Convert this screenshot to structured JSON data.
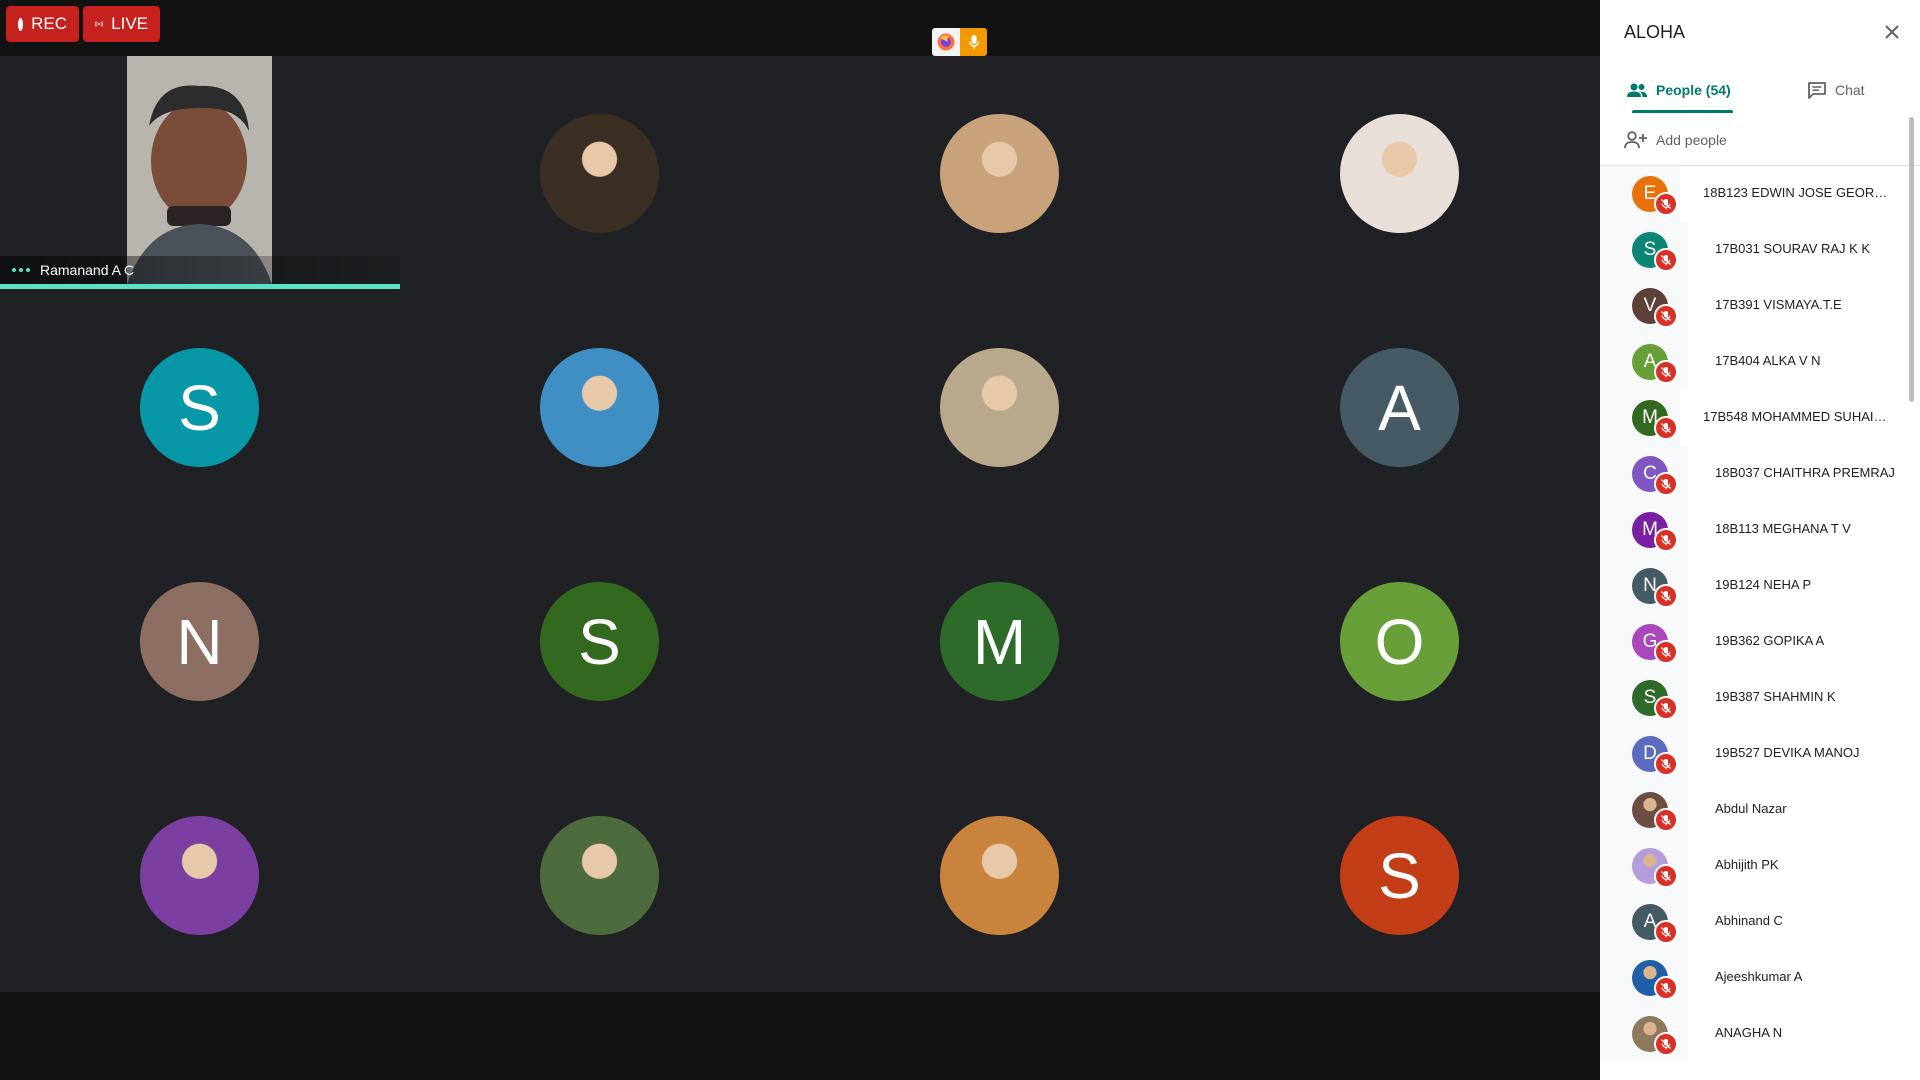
{
  "top_bar": {
    "rec_label": "REC",
    "live_label": "LIVE"
  },
  "speaker_tile": {
    "name": "Ramanand A C"
  },
  "grid_tiles": [
    {
      "type": "photo",
      "color": "#3b2e22"
    },
    {
      "type": "photo",
      "color": "#c7a27a"
    },
    {
      "type": "photo",
      "color": "#e8e0d8"
    },
    {
      "type": "letter",
      "letter": "S",
      "color": "#0897a6"
    },
    {
      "type": "photo",
      "color": "#3f8fc4"
    },
    {
      "type": "photo",
      "color": "#b9a98c"
    },
    {
      "type": "letter",
      "letter": "A",
      "color": "#455a64"
    },
    {
      "type": "letter",
      "letter": "N",
      "color": "#8d6e63"
    },
    {
      "type": "letter",
      "letter": "S",
      "color": "#33691e"
    },
    {
      "type": "letter",
      "letter": "M",
      "color": "#2e6b2a"
    },
    {
      "type": "letter",
      "letter": "O",
      "color": "#689f38"
    },
    {
      "type": "photo",
      "color": "#7a3fa0"
    },
    {
      "type": "photo",
      "color": "#4d6b3c"
    },
    {
      "type": "photo",
      "color": "#c9833c"
    },
    {
      "type": "letter",
      "letter": "S",
      "color": "#c33d17"
    }
  ],
  "panel": {
    "title": "ALOHA",
    "tab_people": "People (54)",
    "tab_chat": "Chat",
    "add_people": "Add people"
  },
  "participants": [
    {
      "name": "18B123 EDWIN JOSE GEORGE ...",
      "initial": "E",
      "color": "#e8710a",
      "wide": true
    },
    {
      "name": "17B031 SOURAV RAJ K K",
      "initial": "S",
      "color": "#0b8574",
      "wide": false
    },
    {
      "name": "17B391 VISMAYA.T.E",
      "initial": "V",
      "color": "#5d4037",
      "wide": false
    },
    {
      "name": "17B404 ALKA V N",
      "initial": "A",
      "color": "#689f38",
      "wide": false
    },
    {
      "name": "17B548 MOHAMMED SUHAIL ...",
      "initial": "M",
      "color": "#33691e",
      "wide": true
    },
    {
      "name": "18B037 CHAITHRA PREMRAJ",
      "initial": "C",
      "color": "#7e57c2",
      "wide": false
    },
    {
      "name": "18B113 MEGHANA T V",
      "initial": "M",
      "color": "#7b1fa2",
      "wide": false
    },
    {
      "name": "19B124 NEHA P",
      "initial": "N",
      "color": "#455a64",
      "wide": false
    },
    {
      "name": "19B362 GOPIKA A",
      "initial": "G",
      "color": "#ab47bc",
      "wide": false
    },
    {
      "name": "19B387 SHAHMIN K",
      "initial": "S",
      "color": "#2e6b2a",
      "wide": false
    },
    {
      "name": "19B527 DEVIKA MANOJ",
      "initial": "D",
      "color": "#5c6bc0",
      "wide": false
    },
    {
      "name": "Abdul Nazar",
      "initial": "",
      "color": "#6d4c41",
      "wide": false
    },
    {
      "name": "Abhijith PK",
      "initial": "",
      "color": "#b39ddb",
      "wide": false
    },
    {
      "name": "Abhinand C",
      "initial": "A",
      "color": "#455a64",
      "wide": false
    },
    {
      "name": "Ajeeshkumar A",
      "initial": "",
      "color": "#1e5fa8",
      "wide": false
    },
    {
      "name": "ANAGHA N",
      "initial": "",
      "color": "#8d7a5c",
      "wide": false
    }
  ]
}
